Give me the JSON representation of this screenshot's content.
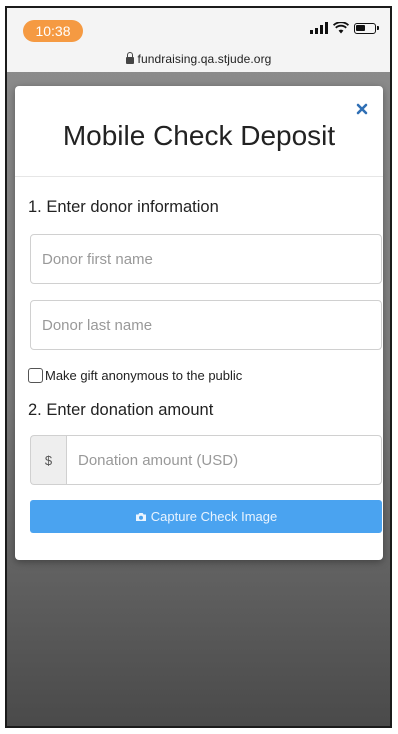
{
  "status_bar": {
    "time": "10:38",
    "url": "fundraising.qa.stjude.org",
    "icons": [
      "signal-icon",
      "wifi-icon",
      "battery-icon",
      "lock-icon"
    ]
  },
  "modal": {
    "title": "Mobile Check Deposit",
    "close_icon": "close-icon"
  },
  "donor_section": {
    "heading": "1. Enter donor information",
    "first_name_placeholder": "Donor first name",
    "last_name_placeholder": "Donor last name",
    "anonymous_label": "Make gift anonymous to the public"
  },
  "amount_section": {
    "heading": "2. Enter donation amount",
    "currency_symbol": "$",
    "amount_placeholder": "Donation amount (USD)"
  },
  "capture_button": {
    "label": "Capture Check Image",
    "icon": "camera-icon"
  },
  "colors": {
    "time_pill": "#f59a42",
    "close_icon": "#2f6fb5",
    "button_blue": "#4aa3f0"
  }
}
